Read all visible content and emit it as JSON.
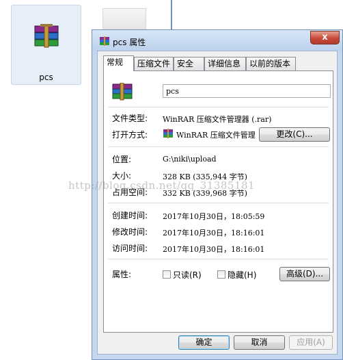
{
  "background": {
    "file_label": "pcs"
  },
  "dialog": {
    "title": "pcs 属性",
    "close_glyph": "x",
    "tabs": [
      "常规",
      "压缩文件",
      "安全",
      "详细信息",
      "以前的版本"
    ],
    "file_name": "pcs",
    "type_label": "文件类型:",
    "type_value": "WinRAR 压缩文件管理器 (.rar)",
    "open_with_label": "打开方式:",
    "open_with_value": "WinRAR 压缩文件管理",
    "change_button": "更改(C)...",
    "location_label": "位置:",
    "location_value": "G:\\niki\\upload",
    "size_label": "大小:",
    "size_value": "328 KB (335,944 字节)",
    "size_on_disk_label": "占用空间:",
    "size_on_disk_value": "332 KB (339,968 字节)",
    "created_label": "创建时间:",
    "created_value": "2017年10月30日，18:05:59",
    "modified_label": "修改时间:",
    "modified_value": "2017年10月30日，18:16:01",
    "accessed_label": "访问时间:",
    "accessed_value": "2017年10月30日，18:16:01",
    "attributes_label": "属性:",
    "readonly_label": "只读(R)",
    "hidden_label": "隐藏(H)",
    "advanced_button": "高级(D)...",
    "ok_button": "确定",
    "cancel_button": "取消",
    "apply_button": "应用(A)"
  },
  "watermark": "http://blog.csdn.net/qq_31385181",
  "icon": "winrar-archive-icon"
}
